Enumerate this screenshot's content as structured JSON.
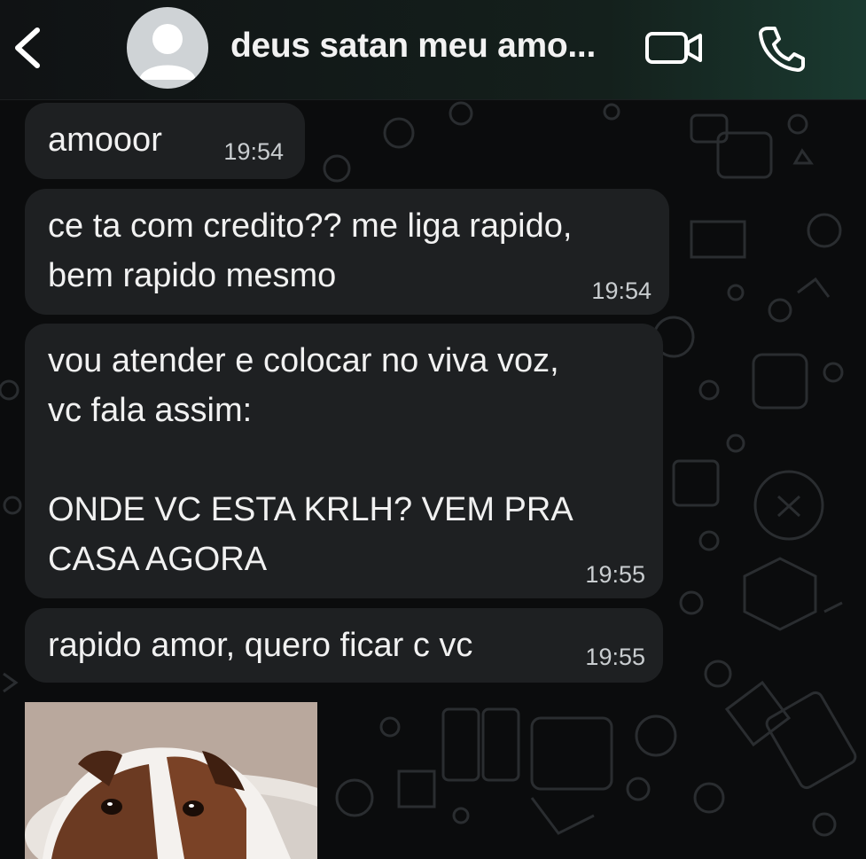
{
  "header": {
    "title": "deus satan meu amo...",
    "back_icon": "chevron-left-icon",
    "avatar_icon": "default-avatar-icon",
    "video_icon": "video-camera-icon",
    "phone_icon": "phone-icon"
  },
  "messages": [
    {
      "text": "amooor",
      "time": "19:54"
    },
    {
      "text": "ce ta com credito?? me liga rapido,\nbem rapido mesmo",
      "time": "19:54"
    },
    {
      "text": "vou atender e colocar no viva voz,\nvc fala assim:\n\nONDE VC ESTA KRLH? VEM PRA\nCASA AGORA",
      "time": "19:55"
    },
    {
      "text": "rapido amor, quero ficar c vc",
      "time": "19:55"
    }
  ],
  "media": {
    "kind": "dog-sticker-image"
  },
  "colors": {
    "background": "#0b0c0d",
    "bubble": "#1e2022",
    "text": "#f1f1f1",
    "time": "#c9cdd0",
    "header_accent": "#1a3a30"
  }
}
